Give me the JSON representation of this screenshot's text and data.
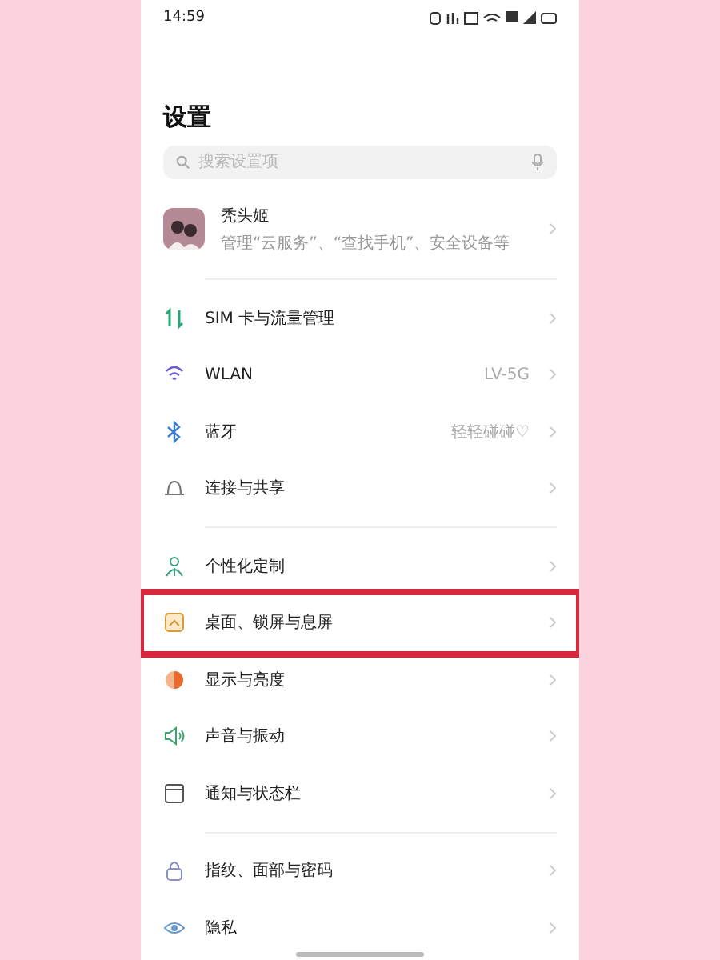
{
  "status_bar": {
    "time": "14:59"
  },
  "title": "设置",
  "search": {
    "placeholder": "搜索设置项"
  },
  "profile": {
    "name": "秃头姬",
    "subtitle": "管理“云服务”、“查找手机”、安全设备等"
  },
  "groups": [
    {
      "items": [
        {
          "kind": "sim",
          "label": "SIM 卡与流量管理",
          "highlighted": false
        },
        {
          "kind": "wifi",
          "label": "WLAN",
          "value": "LV-5G",
          "highlighted": false
        },
        {
          "kind": "bluetooth",
          "label": "蓝牙",
          "value": "轻轻碰碰♡",
          "highlighted": false
        },
        {
          "kind": "share",
          "label": "连接与共享",
          "highlighted": false
        }
      ]
    },
    {
      "items": [
        {
          "kind": "person",
          "label": "个性化定制",
          "highlighted": false
        },
        {
          "kind": "desktop",
          "label": "桌面、锁屏与息屏",
          "highlighted": true
        },
        {
          "kind": "display",
          "label": "显示与亮度",
          "highlighted": false
        },
        {
          "kind": "sound",
          "label": "声音与振动",
          "highlighted": false
        },
        {
          "kind": "notify",
          "label": "通知与状态栏",
          "highlighted": false
        }
      ]
    },
    {
      "items": [
        {
          "kind": "lock",
          "label": "指纹、面部与密码",
          "highlighted": false
        },
        {
          "kind": "eye",
          "label": "隐私",
          "highlighted": false
        }
      ]
    }
  ]
}
